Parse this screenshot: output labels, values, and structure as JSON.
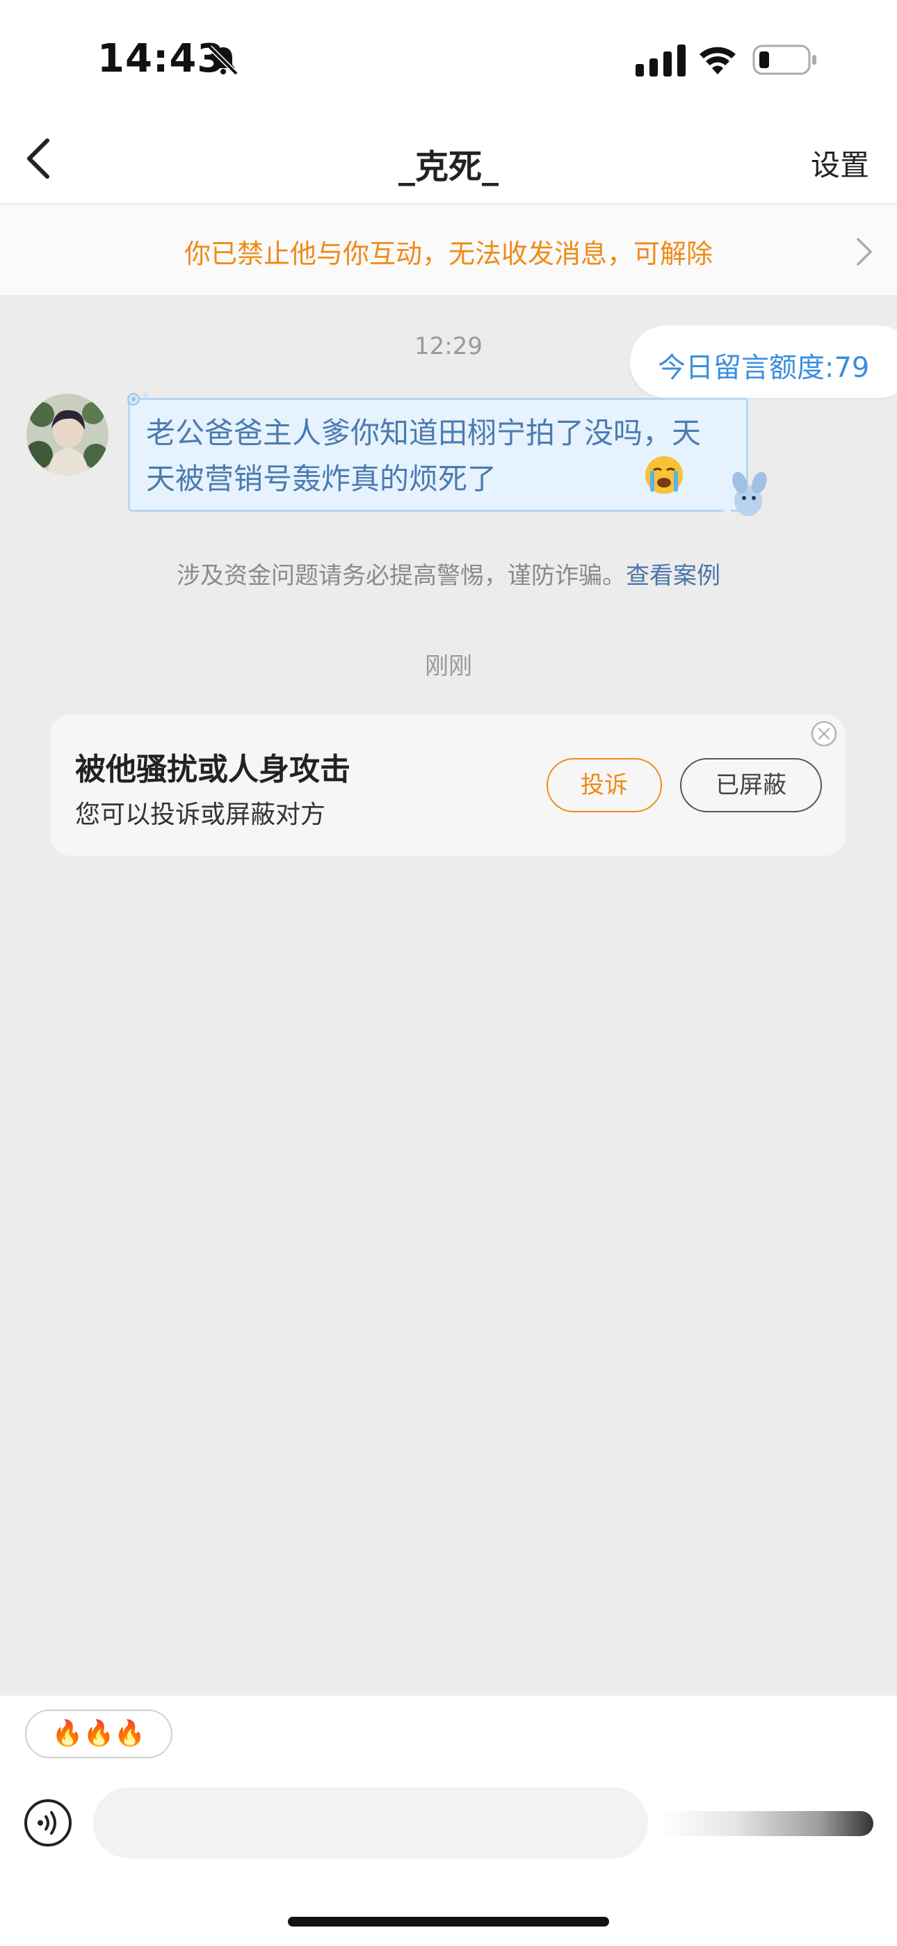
{
  "status_bar": {
    "time": "14:43"
  },
  "nav": {
    "title": "_克死_",
    "settings_label": "设置"
  },
  "banner": {
    "text": "你已禁止他与你互动，无法收发消息，可解除"
  },
  "chat": {
    "timestamp_1": "12:29",
    "quota_label": "今日留言额度:79",
    "message_text": "老公爸爸主人爹你知道田栩宁拍了没吗，天天被营销号轰炸真的烦死了",
    "warning_text": "涉及资金问题请务必提高警惕，谨防诈骗。",
    "warning_link": "查看案例",
    "timestamp_2": "刚刚"
  },
  "card": {
    "title": "被他骚扰或人身攻击",
    "subtitle": "您可以投诉或屏蔽对方",
    "report_label": "投诉",
    "blocked_label": "已屏蔽"
  },
  "input": {
    "quick_reply": "🔥🔥🔥"
  },
  "colors": {
    "accent_orange": "#f08a18",
    "link_blue": "#3a8ee0",
    "bubble_bg": "#e6f2fd"
  },
  "icons": [
    "bell-off-icon",
    "signal-icon",
    "wifi-icon",
    "battery-icon",
    "back-chevron-icon",
    "chevron-right-icon",
    "close-circle-icon",
    "voice-icon",
    "crying-emoji-icon"
  ]
}
